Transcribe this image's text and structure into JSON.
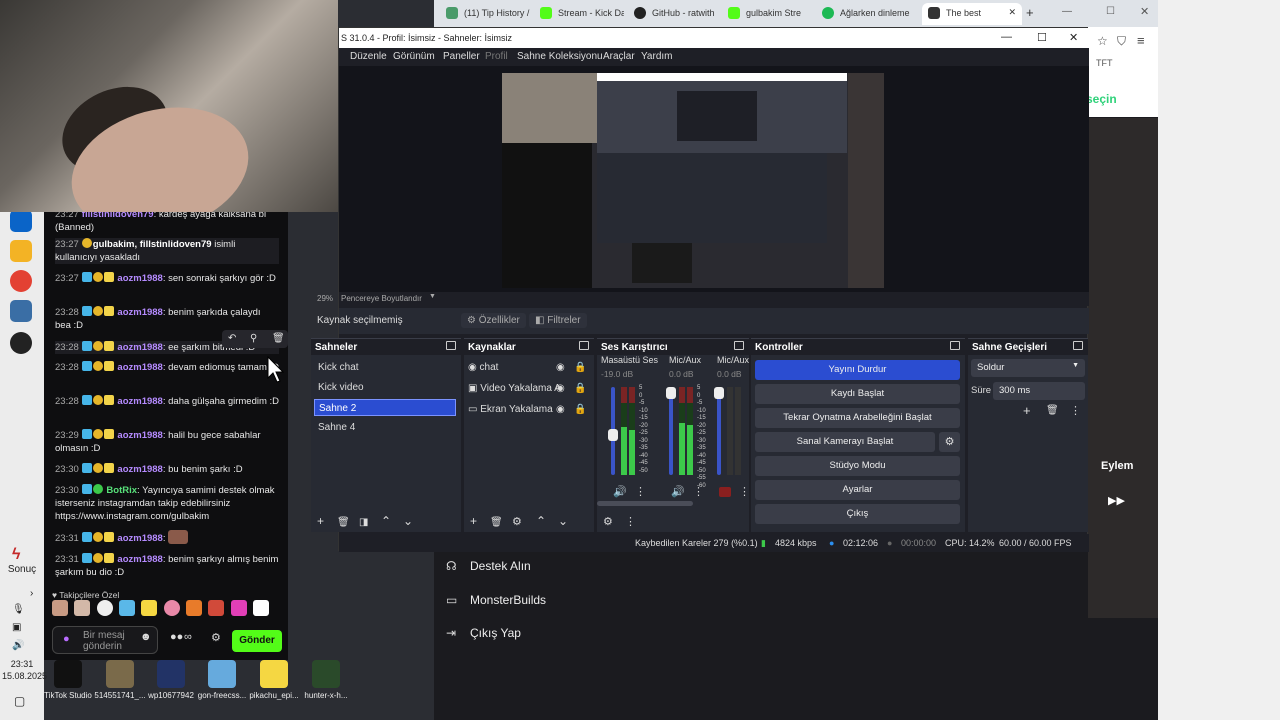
{
  "browser": {
    "tabs": [
      {
        "label": "(11) Tip History /",
        "color": "#4a9b6a"
      },
      {
        "label": "Stream - Kick Das",
        "color": "#53fc18"
      },
      {
        "label": "GitHub - ratwith",
        "color": "#222222"
      },
      {
        "label": "gulbakim Stre",
        "color": "#53fc18"
      },
      {
        "label": "Ağlarken dinleme",
        "color": "#1db954"
      },
      {
        "label": "The best",
        "color": "#333333"
      }
    ],
    "new_tab": "+",
    "tft": "TFT",
    "sec_label": "seçin",
    "profil_label": "profil",
    "eylem": "Eylem",
    "menu": [
      {
        "label": "Destek Alın",
        "icon": "headset-icon"
      },
      {
        "label": "MonsterBuilds",
        "icon": "monitor-icon"
      },
      {
        "label": "Çıkış Yap",
        "icon": "logout-icon"
      }
    ]
  },
  "taskbar": {
    "sonuc": "Sonuç",
    "time": "23:31",
    "date": "15.08.2025"
  },
  "chat": {
    "messages": [
      {
        "time": "23:27",
        "user": "fillstinlidoven79",
        "text": ": kardeş ayağa kalksana bi (Banned)"
      },
      {
        "time": "23:27",
        "user": "gulbakim, fillstinlidoven79",
        "text": " isimli kullanıcıyı yasakladı"
      },
      {
        "time": "23:27",
        "user": "aozm1988",
        "text": ": sen sonraki şarkıyı gör :D"
      },
      {
        "time": "23:28",
        "user": "aozm1988",
        "text": ": benim şarkıda çalaydı bea :D"
      },
      {
        "time": "23:28",
        "user": "aozm1988",
        "text": ": ee şarkım bitmedi :D"
      },
      {
        "time": "23:28",
        "user": "aozm1988",
        "text": ": devam ediomuş tamam :D"
      },
      {
        "time": "23:28",
        "user": "aozm1988",
        "text": ": daha gülşaha girmedim :D"
      },
      {
        "time": "23:29",
        "user": "aozm1988",
        "text": ": halil bu gece sabahlar olmasın :D"
      },
      {
        "time": "23:30",
        "user": "aozm1988",
        "text": ": bu benim şarkı :D"
      },
      {
        "time": "23:30",
        "user": "BotRix",
        "text": ": Yayıncıya samimi destek olmak isterseniz instagramdan takip edebilirsiniz https://www.instagram.com/gulbakim"
      },
      {
        "time": "23:31",
        "user": "aozm1988",
        "text": ":"
      },
      {
        "time": "23:31",
        "user": "aozm1988",
        "text": ": benim şarkıyı almış benim şarkım bu dio :D"
      }
    ],
    "followers_label": "Takipçilere Özel",
    "input_placeholder": "Bir mesaj gönderin",
    "send_label": "Gönder",
    "infinity": "∞"
  },
  "desktop_icons": [
    {
      "label": "TikTok Studio",
      "color": "#111111"
    },
    {
      "label": "514551741_...",
      "color": "#7a6a4a"
    },
    {
      "label": "wp10677942",
      "color": "#223366"
    },
    {
      "label": "gon-freecss...",
      "color": "#66aadd"
    },
    {
      "label": "pikachu_epi...",
      "color": "#f5d742"
    },
    {
      "label": "hunter-x-h...",
      "color": "#2a4a2a"
    }
  ],
  "obs": {
    "title": "S 31.0.4 - Profil: İsimsiz - Sahneler: İsimsiz",
    "menu": [
      "Düzenle",
      "Görünüm",
      "Paneller",
      "Profil",
      "Sahne Koleksiyonu",
      "Araçlar",
      "Yardım"
    ],
    "zoom": "29%",
    "zoom_mode": "Pencereye Boyutlandır",
    "no_source": "Kaynak seçilmemiş",
    "properties": "Özellikler",
    "filters": "Filtreler",
    "scenes_title": "Sahneler",
    "scenes": [
      "Kick chat",
      "Kick video",
      "Sahne 2",
      "Sahne 4"
    ],
    "selected_scene": 2,
    "sources_title": "Kaynaklar",
    "sources": [
      "chat",
      "Video Yakalama A",
      "Ekran Yakalama"
    ],
    "mixer_title": "Ses Karıştırıcı",
    "mixer": [
      {
        "name": "Masaüstü Ses",
        "db": "-19.0 dB",
        "level": 0.55
      },
      {
        "name": "Mic/Aux",
        "db": "0.0 dB",
        "level": 0.6
      },
      {
        "name": "Mic/Aux",
        "db": "0.0 dB",
        "level": 0.4
      }
    ],
    "mixer_scale": [
      "5",
      "0",
      "-5",
      "-10",
      "-15",
      "-20",
      "-25",
      "-30",
      "-35",
      "-40",
      "-45",
      "-50",
      "-55",
      "-60"
    ],
    "controls_title": "Kontroller",
    "controls": [
      "Yayını Durdur",
      "Kaydı Başlat",
      "Tekrar Oynatma Arabelleğini Başlat",
      "Sanal Kamerayı Başlat",
      "Stüdyo Modu",
      "Ayarlar",
      "Çıkış"
    ],
    "transitions_title": "Sahne Geçişleri",
    "transition": "Soldur",
    "duration_label": "Süre",
    "duration": "300 ms",
    "status": {
      "dropped": "Kaybedilen Kareler 279 (%0.1)",
      "bitrate": "4824 kbps",
      "stream_time": "02:12:06",
      "rec_time": "00:00:00",
      "cpu": "CPU: 14.2%",
      "fps": "60.00 / 60.00 FPS"
    }
  }
}
